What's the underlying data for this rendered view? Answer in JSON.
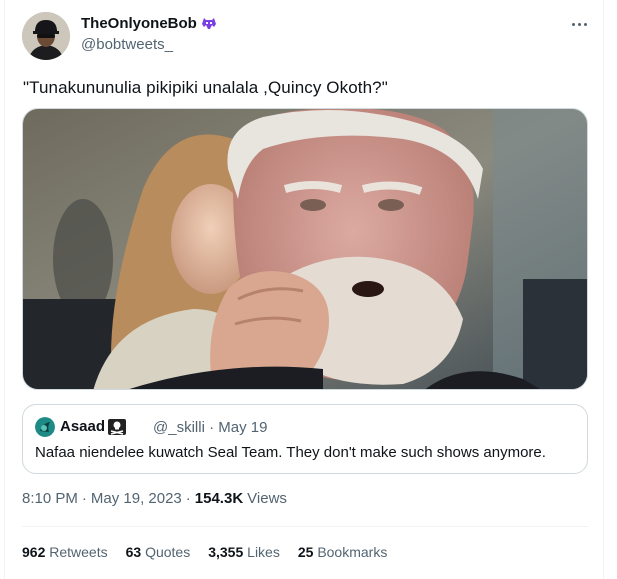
{
  "author": {
    "name": "TheOnlyoneBob",
    "handle": "@bobtweets_"
  },
  "tweet_text": "\"Tunakununulia pikipiki unalala ,Quincy Okoth?\"",
  "quote": {
    "name": "Asaad",
    "handle": "@_skilli",
    "separator": "·",
    "date": "May 19",
    "text": "Nafaa niendelee kuwatch Seal Team. They don't make such shows anymore."
  },
  "timestamp": {
    "time": "8:10 PM",
    "sep1": "·",
    "date": "May 19, 2023",
    "sep2": "·",
    "views_count": "154.3K",
    "views_label": "Views"
  },
  "stats": [
    {
      "count": "962",
      "label": "Retweets"
    },
    {
      "count": "63",
      "label": "Quotes"
    },
    {
      "count": "3,355",
      "label": "Likes"
    },
    {
      "count": "25",
      "label": "Bookmarks"
    }
  ],
  "colors": {
    "text": "#0f1419",
    "secondary": "#536471",
    "border": "#cfd9de",
    "divider": "#eff3f4",
    "badge": "#7b3fe4"
  }
}
